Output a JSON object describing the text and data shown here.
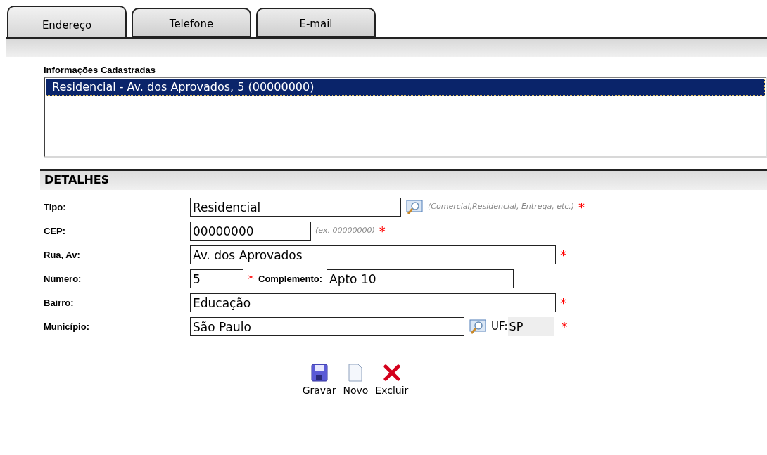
{
  "tabs": [
    {
      "label": "Endereço",
      "selected": true
    },
    {
      "label": "Telefone",
      "selected": false
    },
    {
      "label": "E-mail",
      "selected": false
    }
  ],
  "registered": {
    "title": "Informações Cadastradas",
    "items": [
      {
        "text": "Residencial - Av. dos Aprovados, 5 (00000000)",
        "selected": true
      }
    ]
  },
  "details": {
    "title": "DETALHES",
    "rows": [
      {
        "label": "Tipo:",
        "parts": [
          {
            "kind": "input",
            "value": "Residencial"
          },
          {
            "kind": "lookup"
          },
          {
            "kind": "hint",
            "text": "(Comercial,Residencial, Entrega, etc.)"
          },
          {
            "kind": "required",
            "text": "*"
          }
        ]
      },
      {
        "label": "CEP:",
        "parts": [
          {
            "kind": "input",
            "value": "00000000"
          },
          {
            "kind": "hint",
            "text": "(ex. 00000000)"
          },
          {
            "kind": "required",
            "text": "*"
          }
        ]
      },
      {
        "label": "Rua, Av:",
        "parts": [
          {
            "kind": "input",
            "value": "Av. dos Aprovados"
          },
          {
            "kind": "required",
            "text": "*"
          }
        ]
      },
      {
        "label": "Número:",
        "parts": [
          {
            "kind": "input",
            "value": "5"
          },
          {
            "kind": "required",
            "text": "*"
          },
          {
            "kind": "label",
            "text": "Complemento:"
          },
          {
            "kind": "input",
            "value": "Apto 10"
          }
        ]
      },
      {
        "label": "Bairro:",
        "parts": [
          {
            "kind": "input",
            "value": "Educação"
          },
          {
            "kind": "required",
            "text": "*"
          }
        ]
      },
      {
        "label": "Município:",
        "parts": [
          {
            "kind": "input",
            "value": "São Paulo"
          },
          {
            "kind": "lookup"
          },
          {
            "kind": "plain",
            "text": "UF:"
          },
          {
            "kind": "readonly",
            "value": "SP"
          },
          {
            "kind": "required",
            "text": "*"
          }
        ]
      }
    ]
  },
  "actions": [
    {
      "kind": "save",
      "label": "Gravar"
    },
    {
      "kind": "new",
      "label": "Novo"
    },
    {
      "kind": "delete",
      "label": "Excluir"
    }
  ]
}
